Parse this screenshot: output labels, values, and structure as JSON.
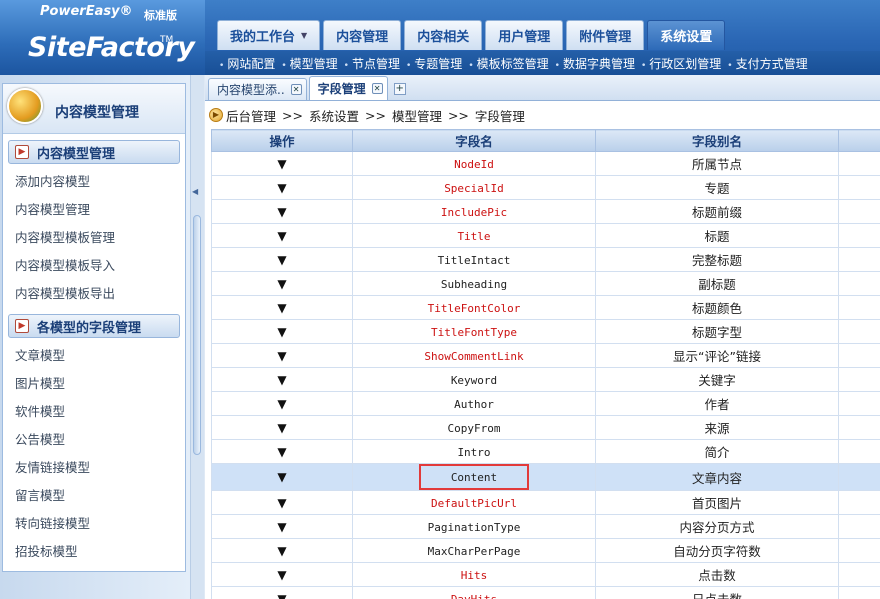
{
  "header": {
    "logo_top": "PowerEasy®",
    "logo_main": "SiteFactory",
    "logo_tm": "TM",
    "edition": "标准版",
    "tabs": [
      {
        "label": "我的工作台",
        "dropdown": true
      },
      {
        "label": "内容管理"
      },
      {
        "label": "内容相关"
      },
      {
        "label": "用户管理"
      },
      {
        "label": "附件管理"
      },
      {
        "label": "系统设置",
        "active": true
      }
    ],
    "subnav": [
      "网站配置",
      "模型管理",
      "节点管理",
      "专题管理",
      "模板标签管理",
      "数据字典管理",
      "行政区划管理",
      "支付方式管理"
    ]
  },
  "sidebar": {
    "title": "内容模型管理",
    "sections": [
      {
        "title": "内容模型管理",
        "items": [
          "添加内容模型",
          "内容模型管理",
          "内容模型模板管理",
          "内容模型模板导入",
          "内容模型模板导出"
        ]
      },
      {
        "title": "各模型的字段管理",
        "items": [
          "文章模型",
          "图片模型",
          "软件模型",
          "公告模型",
          "友情链接模型",
          "留言模型",
          "转向链接模型",
          "招投标模型"
        ]
      }
    ]
  },
  "doc_tabs": [
    {
      "label": "内容模型添.."
    },
    {
      "label": "字段管理",
      "active": true
    }
  ],
  "breadcrumb": [
    "后台管理",
    "系统设置",
    "模型管理",
    "字段管理"
  ],
  "breadcrumb_sep": ">>",
  "table": {
    "columns": [
      "操作",
      "字段名",
      "字段别名"
    ],
    "rows": [
      {
        "name": "NodeId",
        "alias": "所属节点",
        "red": true
      },
      {
        "name": "SpecialId",
        "alias": "专题",
        "red": true
      },
      {
        "name": "IncludePic",
        "alias": "标题前缀",
        "red": true
      },
      {
        "name": "Title",
        "alias": "标题",
        "red": true
      },
      {
        "name": "TitleIntact",
        "alias": "完整标题",
        "red": false
      },
      {
        "name": "Subheading",
        "alias": "副标题",
        "red": false
      },
      {
        "name": "TitleFontColor",
        "alias": "标题颜色",
        "red": true
      },
      {
        "name": "TitleFontType",
        "alias": "标题字型",
        "red": true
      },
      {
        "name": "ShowCommentLink",
        "alias": "显示“评论”链接",
        "red": true
      },
      {
        "name": "Keyword",
        "alias": "关键字",
        "red": false
      },
      {
        "name": "Author",
        "alias": "作者",
        "red": false
      },
      {
        "name": "CopyFrom",
        "alias": "来源",
        "red": false
      },
      {
        "name": "Intro",
        "alias": "简介",
        "red": false
      },
      {
        "name": "Content",
        "alias": "文章内容",
        "red": false,
        "selected": true
      },
      {
        "name": "DefaultPicUrl",
        "alias": "首页图片",
        "red": true
      },
      {
        "name": "PaginationType",
        "alias": "内容分页方式",
        "red": false
      },
      {
        "name": "MaxCharPerPage",
        "alias": "自动分页字符数",
        "red": false
      },
      {
        "name": "Hits",
        "alias": "点击数",
        "red": true
      },
      {
        "name": "DayHits",
        "alias": "日点击数",
        "red": true
      }
    ]
  },
  "colors": {
    "accent": "#2d6ab8",
    "required_field": "#cc1111",
    "highlight_box": "#e23a3a"
  }
}
